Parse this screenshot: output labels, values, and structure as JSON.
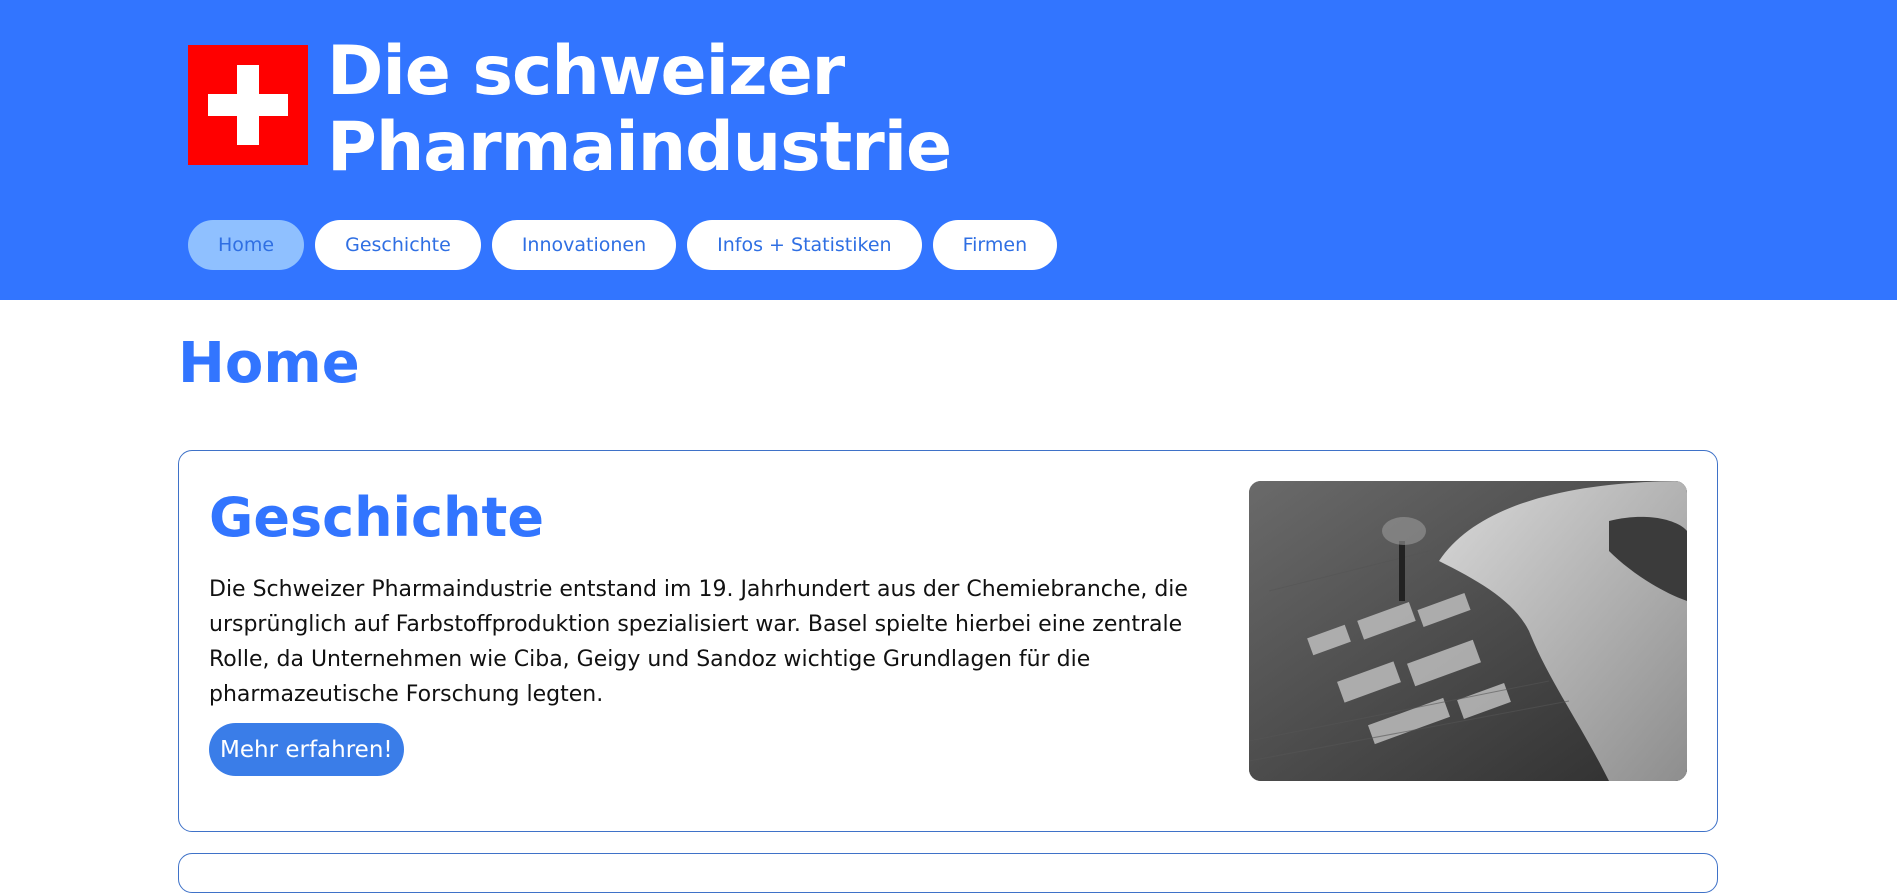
{
  "header": {
    "title_line1": "Die schweizer",
    "title_line2": "Pharmaindustrie",
    "flag_icon": "swiss-flag-icon",
    "colors": {
      "background": "#3275ff",
      "flag_red": "#ff0000"
    }
  },
  "nav": {
    "items": [
      {
        "label": "Home",
        "active": true
      },
      {
        "label": "Geschichte",
        "active": false
      },
      {
        "label": "Innovationen",
        "active": false
      },
      {
        "label": "Infos + Statistiken",
        "active": false
      },
      {
        "label": "Firmen",
        "active": false
      }
    ]
  },
  "main": {
    "page_title": "Home",
    "cards": [
      {
        "title": "Geschichte",
        "text": "Die Schweizer Pharmaindustrie entstand im 19. Jahrhundert aus der Chemiebranche, die ursprünglich auf Farbstoffproduktion spezialisiert war. Basel spielte hierbei eine zentrale Rolle, da Unternehmen wie Ciba, Geigy und Sandoz wichtige Grundlagen für die pharmazeutische Forschung legten.",
        "button_label": "Mehr erfahren!",
        "image_icon": "historical-aerial-photo"
      }
    ]
  }
}
